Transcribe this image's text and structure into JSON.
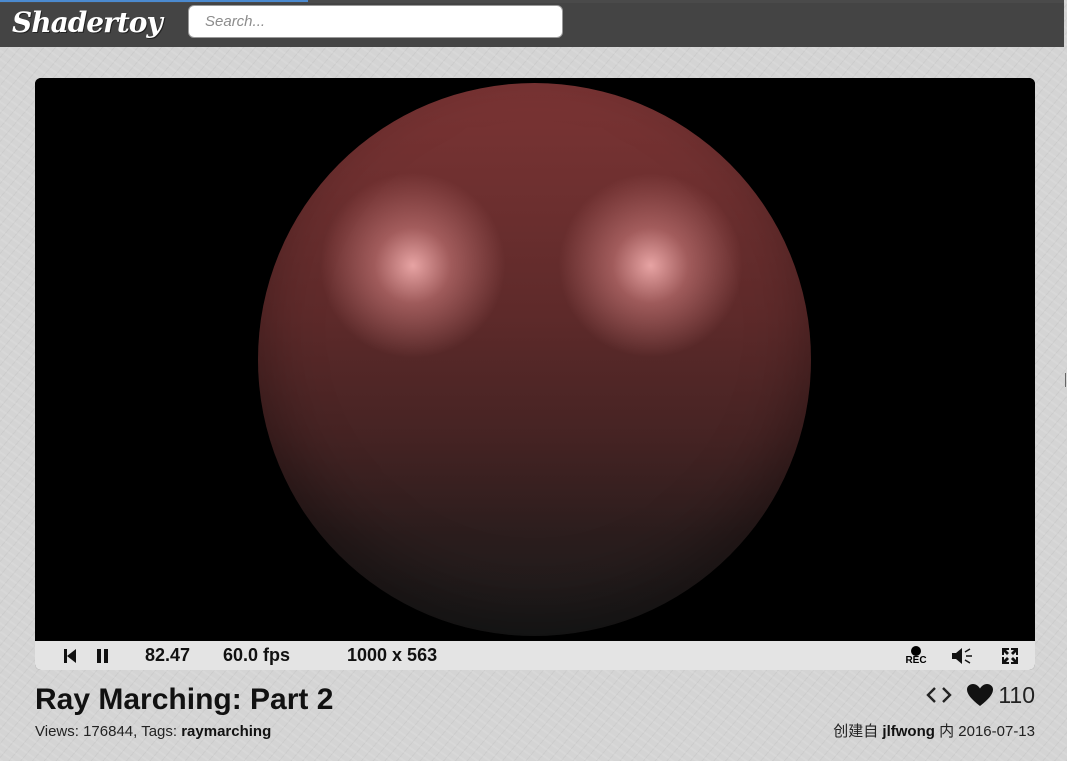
{
  "header": {
    "logo": "Shadertoy",
    "search_placeholder": "Search..."
  },
  "player": {
    "time": "82.47",
    "fps": "60.0 fps",
    "resolution": "1000 x 563",
    "rec_label": "REC",
    "icons": [
      "rewind-icon",
      "pause-icon",
      "record-icon",
      "volume-icon",
      "fullscreen-icon"
    ]
  },
  "shader": {
    "title": "Ray Marching: Part 2",
    "views_label": "Views: 176844, Tags:",
    "tag": "raymarching",
    "likes": "110",
    "credit_prefix": "创建自",
    "author": "jlfwong",
    "credit_mid": "内",
    "date": "2016-07-13"
  },
  "colors": {
    "header_bg": "#444444",
    "controls_bg": "#e4e4e4",
    "sphere": "#6f3030",
    "highlight": "#e8a8a8"
  }
}
